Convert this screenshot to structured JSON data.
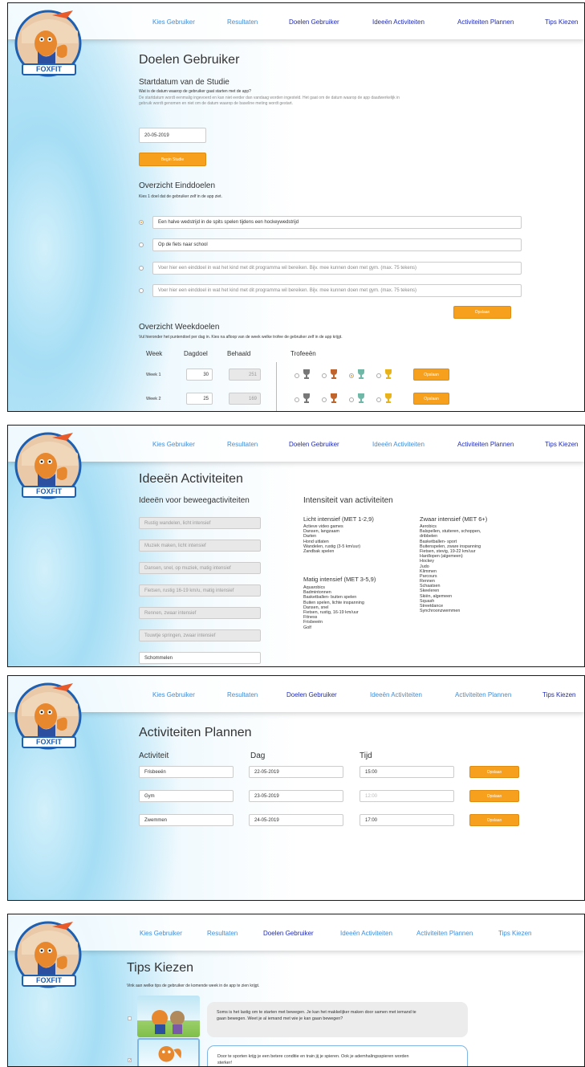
{
  "nav": {
    "kies": "Kies Gebruiker",
    "resultaten": "Resultaten",
    "doelen": "Doelen Gebruiker",
    "ideeen": "Ideeën Activiteiten",
    "plannen": "Activiteiten Plannen",
    "tips": "Tips Kiezen"
  },
  "logo_text": "FOXFIT",
  "colors": {
    "accent": "#f7a01e",
    "nav_light": "#3d8edb",
    "nav_dark": "#1f2bb8"
  },
  "doelen": {
    "title": "Doelen Gebruiker",
    "startdatum_heading": "Startdatum van de Studie",
    "startdatum_question": "Wat is de datum waarop de gebruiker gaat starten met de app?",
    "startdatum_info1": "De startdatum wordt eenmalig ingevoerd en kan niet eerder dan vandaag worden ingesteld. Het gaat om de datum waarop de app daadwerkelijk in",
    "startdatum_info2": "gebruik wordt genomen en niet om de datum waarop de baseline meting wordt gestart.",
    "date_value": "20-05-2019",
    "begin_label": "Begin Studie",
    "eind_heading": "Overzicht Einddoelen",
    "eind_sub": "Kies 1 doel dat de gebruiker zelf in de app ziet.",
    "goals": [
      "Een halve wedstrijd in de spits spelen tijdens een hockeywedstrijd",
      "Op de fiets naar school",
      "Voer hier een einddoel in wat het kind met dit programma wil bereiken. Bijv. mee kunnen doen met gym. (max. 75 tekens)",
      "Voer hier een einddoel in wat het kind met dit programma wil bereiken. Bijv. mee kunnen doen met gym. (max. 75 tekens)"
    ],
    "opslaan": "Opslaan",
    "week_heading": "Overzicht Weekdoelen",
    "week_sub": "Vul hieronder het puntendoel per dag in. Kies na afloop van de week welke trofee de gebruiker zelf in de app krijgt.",
    "col_week": "Week",
    "col_dagdoel": "Dagdoel",
    "col_behaald": "Behaald",
    "col_trofeeen": "Trofeeën",
    "weeks": [
      {
        "label": "Week 1",
        "dagdoel": "30",
        "behaald": "251"
      },
      {
        "label": "Week 2",
        "dagdoel": "25",
        "behaald": "169"
      }
    ]
  },
  "ideeen": {
    "title": "Ideeën Activiteiten",
    "col1_heading": "Ideeën voor beweegactiviteiten",
    "col2_heading": "Intensiteit van activiteiten",
    "ideas": [
      "Rustig wandelen, licht intensief",
      "Muziek maken, licht intensief",
      "Dansen, snel, op muziek, matig intensief",
      "Fietsen, rustig 16-19 km/u, matig intensief",
      "Rennen, zwaar intensief",
      "Touwtje springen, zwaar intensief",
      "Schommelen"
    ],
    "licht_heading": "Licht intensief (MET 1-2,9)",
    "licht": [
      "Actieve video games",
      "Dansen, langzaam",
      "Darten",
      "Hond uitlaten",
      "Wandelen, rustig (3-5 km/uur)",
      "Zandbak spelen"
    ],
    "matig_heading": "Matig intensief (MET 3-5,9)",
    "matig": [
      "Aquarobics",
      "Badmintonnen",
      "Basketballen- buiten spelen",
      "Buiten spelen, lichte inspanning",
      "Dansen, snel",
      "Fietsen, rustig, 16-19 km/uur",
      "Fitness",
      "Frisbeeën",
      "Golf"
    ],
    "zwaar_heading": "Zwaar intensief (MET 6+)",
    "zwaar": [
      "Aerobics",
      "Balspellen, stuiteren, schoppen,",
      "dribbelen",
      "Basketballen- sport",
      "Buitenspelen, zware inspanning",
      "Fietsen, stevig, 19-22 km/uur",
      "Hardlopen (algemeen)",
      "Hockey",
      "Judo",
      "Klimmen",
      "Parcours",
      "Rennen",
      "Schaatsen",
      "Skeeleren",
      "Skiën, algemeen",
      "Squash",
      "Streetdance",
      "Synchroonzwemmen"
    ]
  },
  "plannen": {
    "title": "Activiteiten Plannen",
    "col_activiteit": "Activiteit",
    "col_dag": "Dag",
    "col_tijd": "Tijd",
    "rows": [
      {
        "activiteit": "Frisbeeën",
        "dag": "22-05-2019",
        "tijd": "15:00"
      },
      {
        "activiteit": "Gym",
        "dag": "23-05-2019",
        "tijd": "12:00"
      },
      {
        "activiteit": "Zwemmen",
        "dag": "24-05-2019",
        "tijd": "17:00"
      }
    ],
    "opslaan": "Opslaan"
  },
  "tips": {
    "title": "Tips Kiezen",
    "sub": "Vink aan welke tips de gebruiker de komende week in de app te zien krijgt.",
    "tip1a": "Soms is het lastig om te starten met bewegen. Je kan het makkelijker maken door samen met iemand te",
    "tip1b": "gaan bewegen. Weet je al iemand met wie je kan gaan bewegen?",
    "tip2a": "Door te sporten krijg je een betere conditie en train jij je spieren. Ook je ademhalingsspieren worden",
    "tip2b": "sterker!",
    "tip2_check": "✓"
  }
}
